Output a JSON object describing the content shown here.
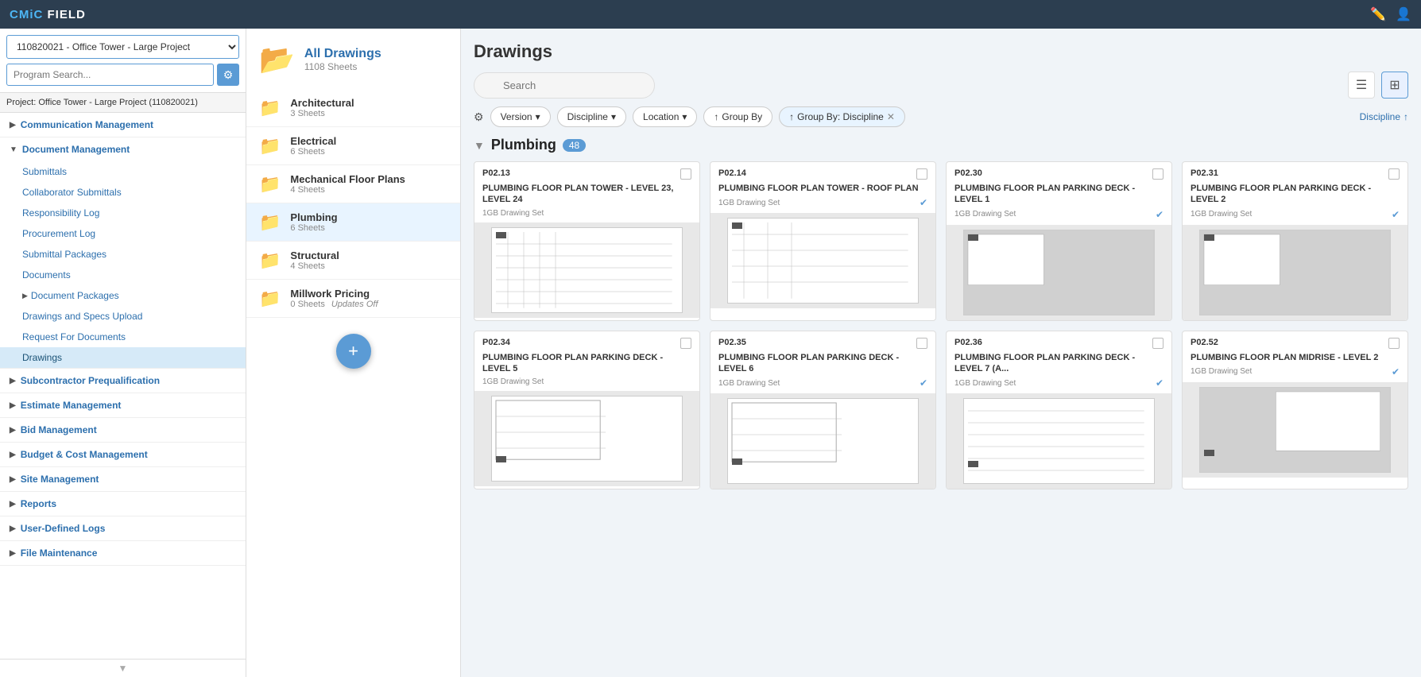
{
  "topbar": {
    "logo": "CMiC FIELD",
    "logo_accent": "CMiC",
    "icons": [
      "edit-icon",
      "user-icon"
    ]
  },
  "sidebar": {
    "project_dropdown": "110820021 - Office Tower - Large Project",
    "search_placeholder": "Program Search...",
    "project_label": "Project: Office Tower - Large Project (110820021)",
    "sections": [
      {
        "label": "Communication Management",
        "expanded": false,
        "items": []
      },
      {
        "label": "Document Management",
        "expanded": true,
        "items": [
          {
            "label": "Submittals",
            "active": false
          },
          {
            "label": "Collaborator Submittals",
            "active": false
          },
          {
            "label": "Responsibility Log",
            "active": false
          },
          {
            "label": "Procurement Log",
            "active": false
          },
          {
            "label": "Submittal Packages",
            "active": false
          },
          {
            "label": "Documents",
            "active": false
          },
          {
            "label": "Document Packages",
            "active": false,
            "has_arrow": true
          },
          {
            "label": "Drawings and Specs Upload",
            "active": false
          },
          {
            "label": "Request For Documents",
            "active": false
          },
          {
            "label": "Drawings",
            "active": true
          }
        ]
      },
      {
        "label": "Subcontractor Prequalification",
        "expanded": false,
        "items": []
      },
      {
        "label": "Estimate Management",
        "expanded": false,
        "items": []
      },
      {
        "label": "Bid Management",
        "expanded": false,
        "items": []
      },
      {
        "label": "Budget & Cost Management",
        "expanded": false,
        "items": []
      },
      {
        "label": "Site Management",
        "expanded": false,
        "items": []
      },
      {
        "label": "Reports",
        "expanded": false,
        "items": []
      },
      {
        "label": "User-Defined Logs",
        "expanded": false,
        "items": []
      },
      {
        "label": "File Maintenance",
        "expanded": false,
        "items": []
      }
    ]
  },
  "folder_panel": {
    "all_drawings": {
      "label": "All Drawings",
      "count": "1108 Sheets"
    },
    "folders": [
      {
        "label": "Architectural",
        "count": "3 Sheets"
      },
      {
        "label": "Electrical",
        "count": "6 Sheets"
      },
      {
        "label": "Mechanical Floor Plans",
        "count": "4 Sheets"
      },
      {
        "label": "Plumbing",
        "count": "6 Sheets",
        "active": true
      },
      {
        "label": "Structural",
        "count": "4 Sheets"
      },
      {
        "label": "Millwork Pricing",
        "count": "0 Sheets",
        "updates_off": "Updates Off"
      }
    ],
    "fab_label": "+"
  },
  "content": {
    "title": "Drawings",
    "search_placeholder": "Search",
    "filters": {
      "version_label": "Version",
      "discipline_label": "Discipline",
      "location_label": "Location",
      "group_by_label": "Group By",
      "group_by_active_label": "Group By: Discipline",
      "discipline_sort_label": "Discipline"
    },
    "group": {
      "title": "Plumbing",
      "count": "48"
    },
    "drawings": [
      {
        "code": "P02.13",
        "name": "PLUMBING FLOOR PLAN TOWER - LEVEL 23, LEVEL 24",
        "set": "1GB Drawing Set",
        "verified": false
      },
      {
        "code": "P02.14",
        "name": "PLUMBING FLOOR PLAN TOWER - ROOF PLAN",
        "set": "1GB Drawing Set",
        "verified": true
      },
      {
        "code": "P02.30",
        "name": "PLUMBING FLOOR PLAN PARKING DECK - LEVEL 1",
        "set": "1GB Drawing Set",
        "verified": true
      },
      {
        "code": "P02.31",
        "name": "PLUMBING FLOOR PLAN PARKING DECK - LEVEL 2",
        "set": "1GB Drawing Set",
        "verified": true
      },
      {
        "code": "P02.34",
        "name": "PLUMBING FLOOR PLAN PARKING DECK - LEVEL 5",
        "set": "1GB Drawing Set",
        "verified": false
      },
      {
        "code": "P02.35",
        "name": "PLUMBING FLOOR PLAN PARKING DECK - LEVEL 6",
        "set": "1GB Drawing Set",
        "verified": true
      },
      {
        "code": "P02.36",
        "name": "PLUMBING FLOOR PLAN PARKING DECK - LEVEL 7 (A...",
        "set": "1GB Drawing Set",
        "verified": true
      },
      {
        "code": "P02.52",
        "name": "PLUMBING FLOOR PLAN MIDRISE - LEVEL 2",
        "set": "1GB Drawing Set",
        "verified": true
      }
    ]
  }
}
